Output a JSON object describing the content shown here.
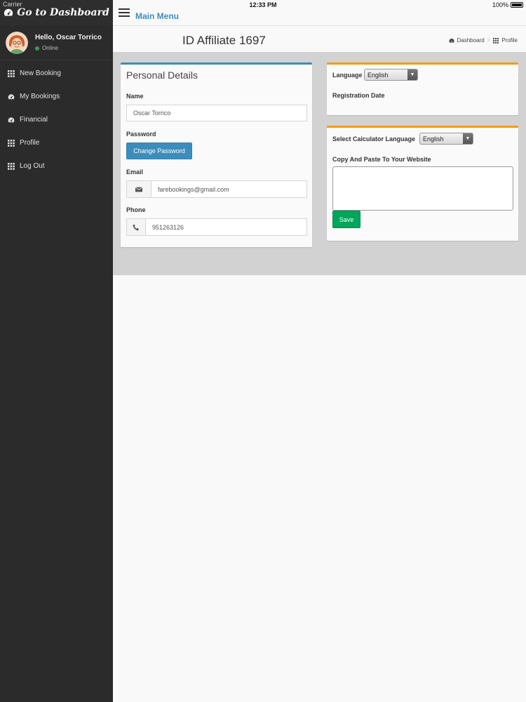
{
  "status_bar": {
    "carrier": "Carrier",
    "time": "12:33 PM",
    "battery": "100%"
  },
  "sidebar": {
    "brand": "Go to Dashboard",
    "user": {
      "greeting": "Hello, Oscar Torrico",
      "status": "Online"
    },
    "items": [
      {
        "label": "New Booking",
        "icon": "grid-icon"
      },
      {
        "label": "My Bookings",
        "icon": "dashboard-icon"
      },
      {
        "label": "Financial",
        "icon": "dashboard-icon"
      },
      {
        "label": "Profile",
        "icon": "grid-icon"
      },
      {
        "label": "Log Out",
        "icon": "grid-icon"
      }
    ]
  },
  "header": {
    "title": "Main Menu"
  },
  "content_header": {
    "title": "ID Affiliate 1697",
    "breadcrumb": [
      "Dashboard",
      "Profile"
    ]
  },
  "personal": {
    "title": "Personal Details",
    "name_label": "Name",
    "name_value": "Oscar Torrico",
    "password_label": "Password",
    "change_password": "Change Password",
    "email_label": "Email",
    "email_value": "farebookings@gmail.com",
    "phone_label": "Phone",
    "phone_value": "951263126"
  },
  "language": {
    "label": "Language",
    "selected": "English",
    "registration_label": "Registration Date"
  },
  "calculator": {
    "label": "Select Calculator Language",
    "selected": "English",
    "copy_label": "Copy And Paste To Your Website",
    "save": "Save"
  },
  "colors": {
    "sidebar_bg": "#2b2b2b",
    "primary": "#3c8dbc",
    "success": "#00a65a",
    "warning": "#f39c12",
    "content_bg": "#d2d2d2"
  }
}
